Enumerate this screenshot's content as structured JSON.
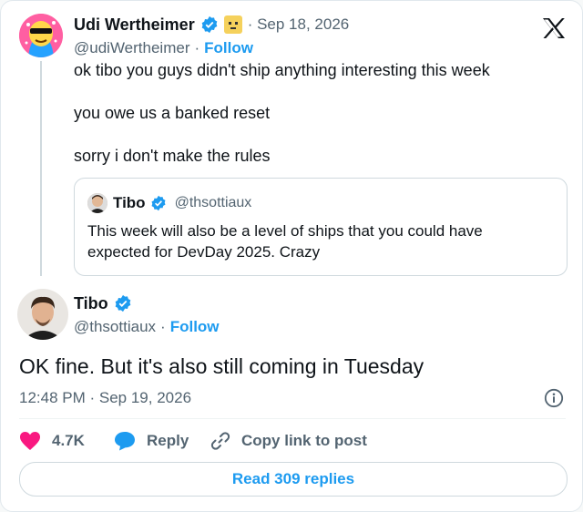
{
  "colors": {
    "accent": "#1d9bf0",
    "like": "#f91880",
    "text": "#0f1419",
    "muted": "#536471"
  },
  "tweet": {
    "author_name": "Udi Wertheimer",
    "date": "· Sep 18, 2026",
    "handle": "@udiWertheimer",
    "follow_sep": "·",
    "follow": "Follow",
    "lines": [
      "ok tibo you guys didn't ship anything interesting this week",
      "you owe us a banked reset",
      "sorry i don't make the rules"
    ]
  },
  "quote": {
    "author_name": "Tibo",
    "handle": "@thsottiaux",
    "line1": "This week will also be a level of ships that you could have",
    "line2": "expected for DevDay 2025. Crazy"
  },
  "reply": {
    "author_name": "Tibo",
    "handle": "@thsottiaux",
    "follow_sep": "·",
    "follow": "Follow",
    "text": "OK fine. But it's also still coming in Tuesday",
    "timestamp": "12:48 PM · Sep 19, 2026"
  },
  "actions": {
    "likes": "4.7K",
    "reply": "Reply",
    "copy_link": "Copy link to post"
  },
  "read_replies": "Read 309 replies",
  "icons": [
    "x-logo-icon",
    "verified-badge-icon",
    "emoji-icon",
    "info-icon",
    "heart-icon",
    "reply-bubble-icon",
    "link-icon"
  ]
}
